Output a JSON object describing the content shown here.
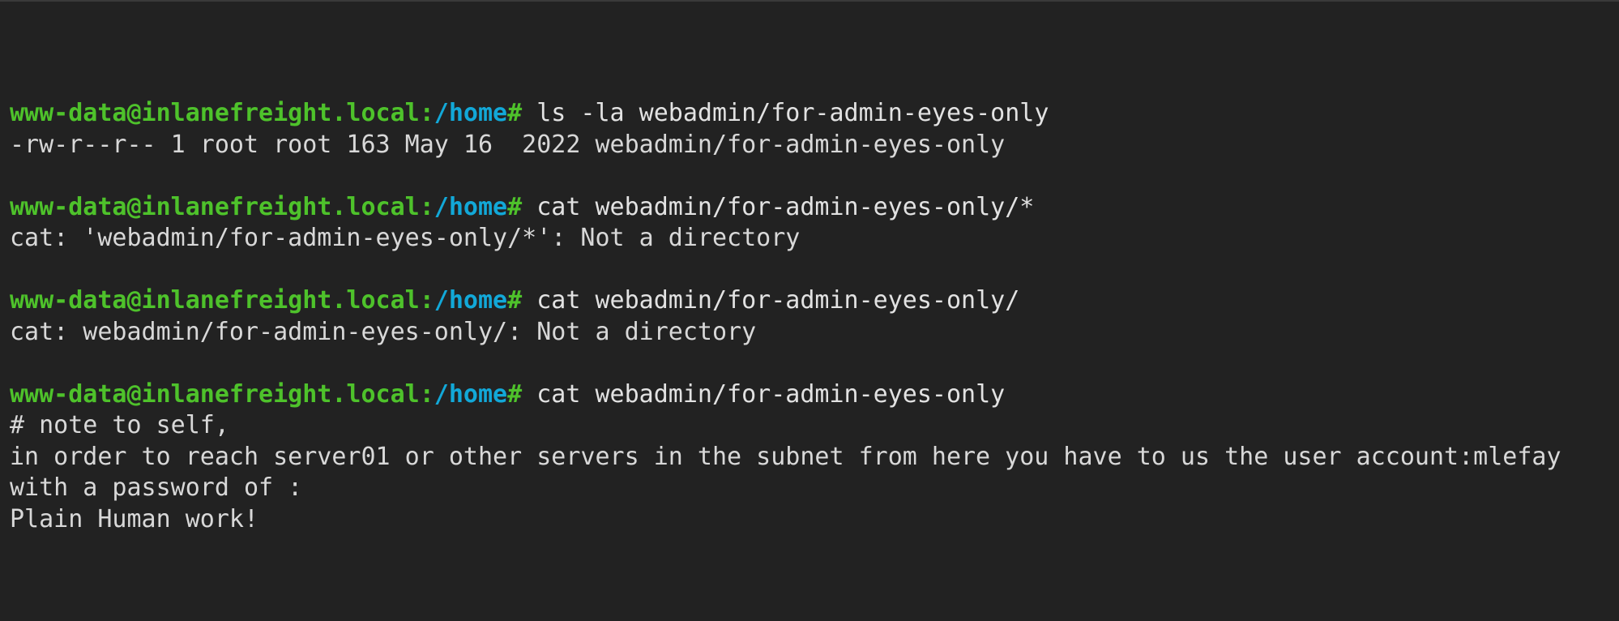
{
  "terminal": {
    "prompt": {
      "user_host": "www-data@inlanefreight.local:",
      "cwd": "/home",
      "symbol": "#"
    },
    "blocks": [
      {
        "command": "ls -la webadmin/for-admin-eyes-only",
        "output": [
          "-rw-r--r-- 1 root root 163 May 16  2022 webadmin/for-admin-eyes-only"
        ]
      },
      {
        "command": "cat webadmin/for-admin-eyes-only/*",
        "output": [
          "cat: 'webadmin/for-admin-eyes-only/*': Not a directory"
        ]
      },
      {
        "command": "cat webadmin/for-admin-eyes-only/",
        "output": [
          "cat: webadmin/for-admin-eyes-only/: Not a directory"
        ]
      },
      {
        "command": "cat webadmin/for-admin-eyes-only",
        "output": [
          "# note to self,",
          "in order to reach server01 or other servers in the subnet from here you have to us the user account:mlefay",
          "with a password of :",
          "Plain Human work!"
        ]
      }
    ]
  }
}
